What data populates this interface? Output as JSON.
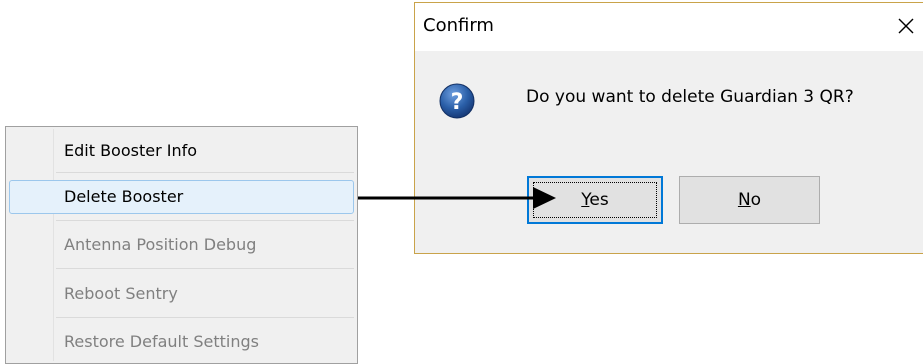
{
  "context_menu": {
    "items": [
      {
        "label": "Edit Booster Info",
        "state": "enabled"
      },
      {
        "label": "Delete Booster",
        "state": "selected"
      },
      {
        "label": "Antenna Position Debug",
        "state": "disabled"
      },
      {
        "label": "Reboot Sentry",
        "state": "disabled"
      },
      {
        "label": "Restore Default Settings",
        "state": "disabled"
      }
    ]
  },
  "dialog": {
    "title": "Confirm",
    "message": "Do you want to delete Guardian 3 QR?",
    "icon": "question-icon",
    "buttons": {
      "yes": {
        "pre": "",
        "mnemonic": "Y",
        "post": "es"
      },
      "no": {
        "pre": "",
        "mnemonic": "N",
        "post": "o"
      }
    }
  },
  "colors": {
    "menu_bg": "#f0f0f0",
    "menu_highlight": "#e5f1fb",
    "menu_highlight_border": "#9cc7ec",
    "disabled_text": "#808080",
    "dialog_border": "#c9a34a",
    "default_button_border": "#0078d7",
    "question_icon_blue": "#2a5fa8"
  }
}
